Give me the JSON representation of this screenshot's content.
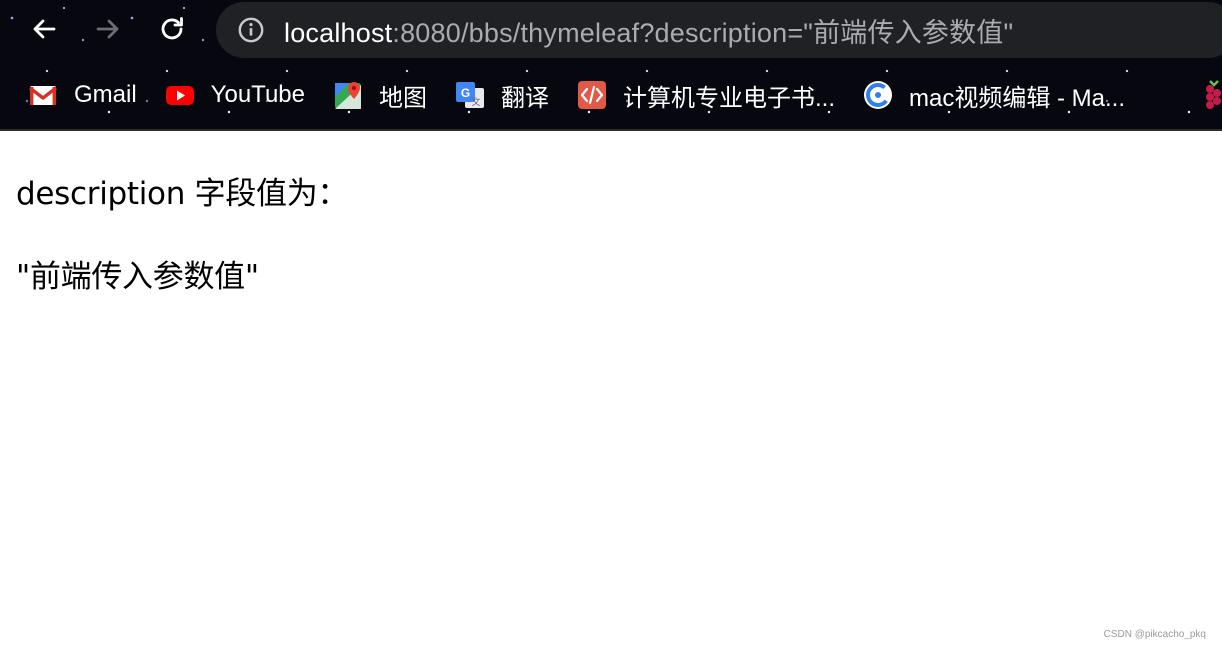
{
  "browser": {
    "address_bar": {
      "host": "localhost",
      "path": ":8080/bbs/thymeleaf?description=\"前端传入参数值\""
    },
    "icons": {
      "back": "arrow-left-icon",
      "forward": "arrow-right-icon",
      "reload": "reload-icon",
      "site_info": "info-circle-icon"
    },
    "bookmarks": [
      {
        "label": "Gmail",
        "icon": "gmail-icon"
      },
      {
        "label": "YouTube",
        "icon": "youtube-icon"
      },
      {
        "label": "地图",
        "icon": "maps-icon"
      },
      {
        "label": "翻译",
        "icon": "translate-icon"
      },
      {
        "label": "计算机专业电子书...",
        "icon": "code-icon"
      },
      {
        "label": "mac视频编辑 - Ma...",
        "icon": "c-circle-icon"
      }
    ]
  },
  "page": {
    "field_label": "description 字段值为：",
    "field_value": "\"前端传入参数值\""
  },
  "watermark": "CSDN @pikcacho_pkq",
  "colors": {
    "omnibox_bg": "#202124",
    "url_host": "#ffffff",
    "url_path": "#a9abb0",
    "page_bg": "#ffffff"
  }
}
